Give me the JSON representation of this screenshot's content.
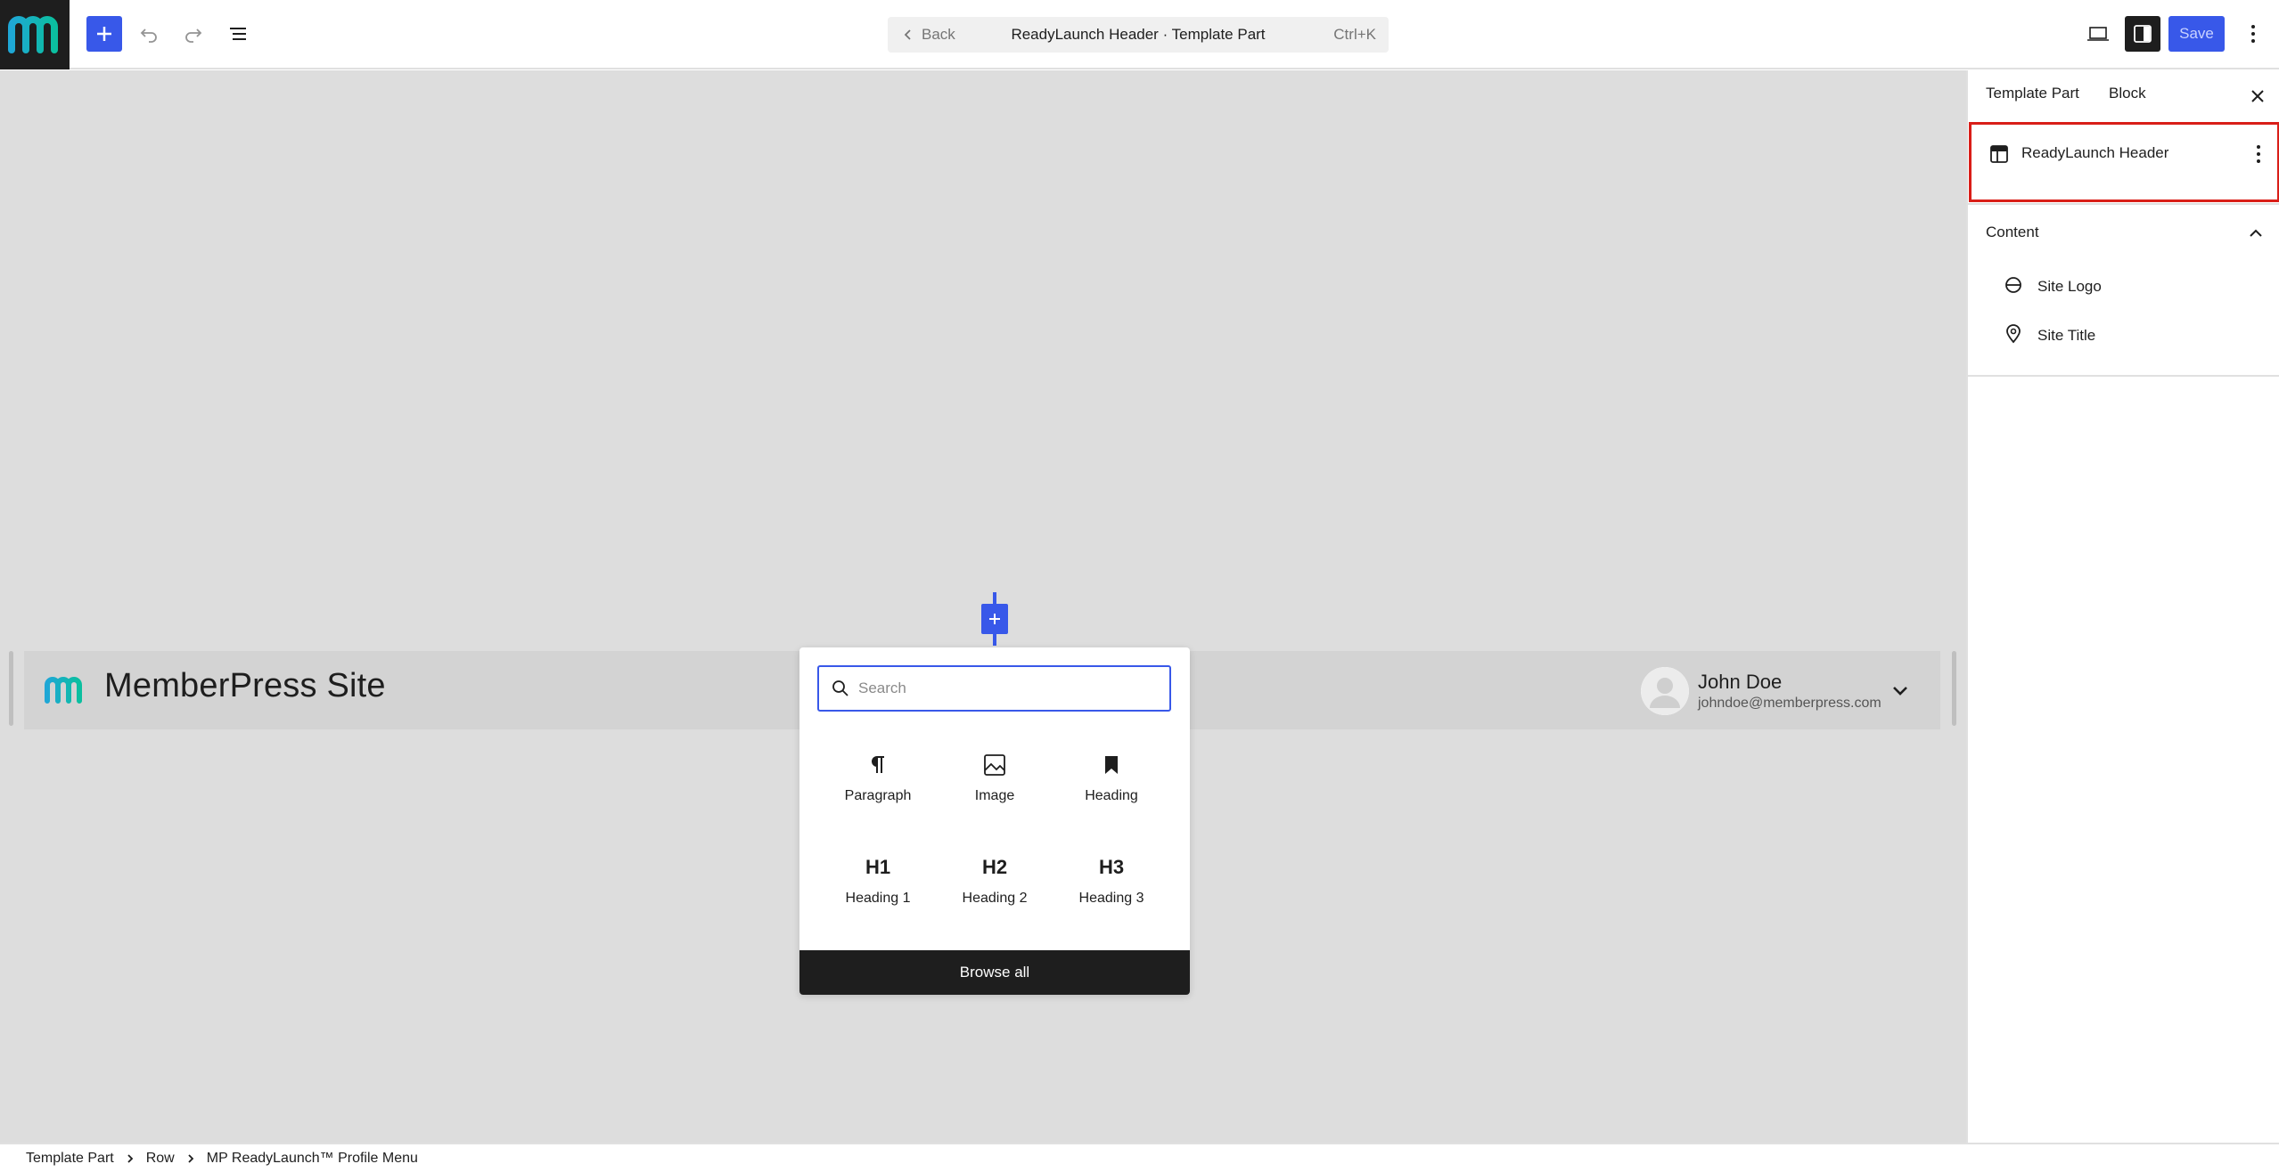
{
  "topbar": {
    "back_label": "Back",
    "document_title": "ReadyLaunch Header · Template Part",
    "shortcut": "Ctrl+K",
    "save_label": "Save"
  },
  "canvas": {
    "site_title": "MemberPress Site",
    "profile": {
      "name": "John Doe",
      "email": "johndoe@memberpress.com"
    }
  },
  "inserter": {
    "search_placeholder": "Search",
    "blocks": [
      {
        "label": "Paragraph",
        "icon": "paragraph-icon"
      },
      {
        "label": "Image",
        "icon": "image-icon"
      },
      {
        "label": "Heading",
        "icon": "bookmark-icon"
      },
      {
        "label": "Heading 1",
        "icon_text": "H1"
      },
      {
        "label": "Heading 2",
        "icon_text": "H2"
      },
      {
        "label": "Heading 3",
        "icon_text": "H3"
      }
    ],
    "browse_all": "Browse all"
  },
  "sidebar": {
    "tabs": [
      "Template Part",
      "Block"
    ],
    "card_title": "ReadyLaunch Header",
    "section_title": "Content",
    "content_items": [
      {
        "label": "Site Logo",
        "icon": "site-logo-icon"
      },
      {
        "label": "Site Title",
        "icon": "map-pin-icon"
      }
    ]
  },
  "breadcrumb": [
    "Template Part",
    "Row",
    "MP ReadyLaunch™ Profile Menu"
  ],
  "colors": {
    "accent": "#3858e9",
    "dark": "#1e1e1e",
    "canvas_bg": "#dddddd",
    "highlight": "#d91e18"
  }
}
